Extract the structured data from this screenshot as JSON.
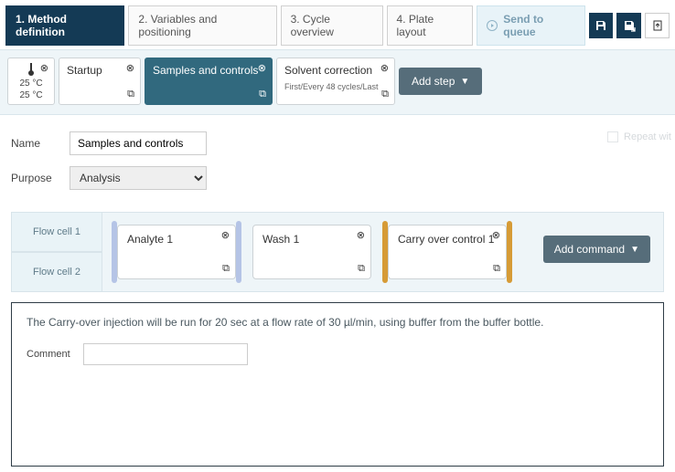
{
  "tabs": [
    {
      "label": "1. Method definition",
      "active": true
    },
    {
      "label": "2. Variables and positioning",
      "active": false
    },
    {
      "label": "3. Cycle overview",
      "active": false
    },
    {
      "label": "4. Plate layout",
      "active": false
    }
  ],
  "queue_btn": "Send to queue",
  "toolbar_icons": [
    "save-icon",
    "save-as-icon",
    "export-icon"
  ],
  "temp": {
    "line1": "25 °C",
    "line2": "25 °C"
  },
  "steps": [
    {
      "title": "Startup",
      "active": false
    },
    {
      "title": "Samples and controls",
      "active": true
    },
    {
      "title": "Solvent correction",
      "sub": "First/Every 48 cycles/Last",
      "active": false
    }
  ],
  "add_step_label": "Add step",
  "fields": {
    "name_label": "Name",
    "name_value": "Samples and controls",
    "purpose_label": "Purpose",
    "purpose_value": "Analysis",
    "repeat_label": "Repeat wit"
  },
  "flow_labels": [
    "Flow cell 1",
    "Flow cell 2"
  ],
  "commands": [
    {
      "title": "Analyte 1",
      "halo": "blue"
    },
    {
      "title": "Wash 1",
      "halo": "none"
    },
    {
      "title": "Carry over control 1",
      "halo": "orange"
    }
  ],
  "add_command_label": "Add command",
  "detail": {
    "description": "The Carry-over injection will be run for 20 sec at a flow rate of 30 µl/min, using buffer from the buffer bottle.",
    "comment_label": "Comment",
    "comment_value": ""
  }
}
